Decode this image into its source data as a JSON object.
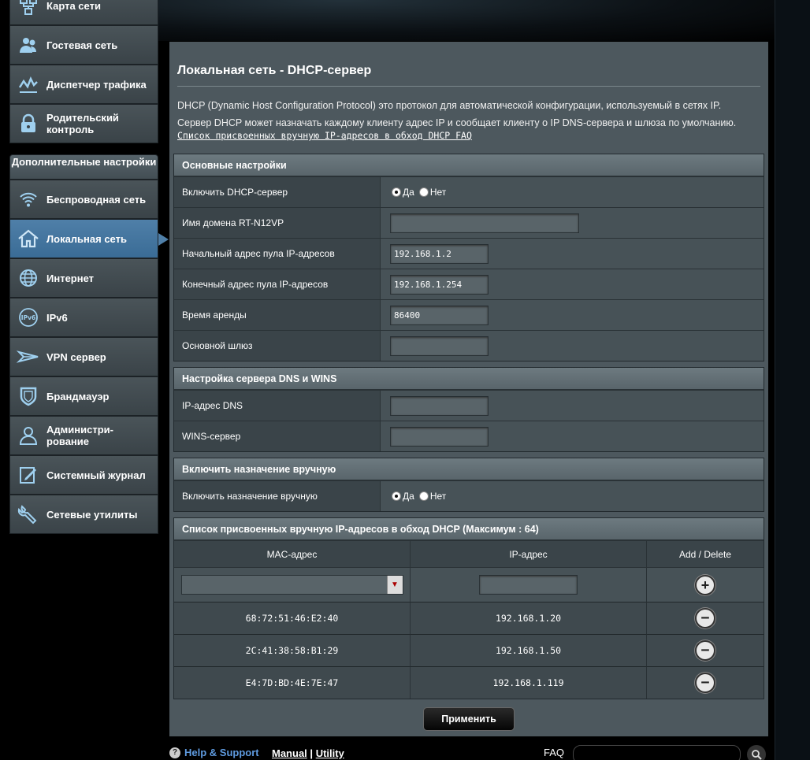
{
  "sidebar": {
    "items_top": [
      {
        "label": "Карта сети",
        "icon": "network-map-icon"
      },
      {
        "label": "Гостевая сеть",
        "icon": "guest-network-icon"
      },
      {
        "label": "Диспетчер трафика",
        "icon": "traffic-manager-icon"
      },
      {
        "label": "Родительский контроль",
        "icon": "parental-control-icon"
      }
    ],
    "section_label": "Дополнительные настройки",
    "items_adv": [
      {
        "label": "Беспроводная сеть",
        "icon": "wireless-icon"
      },
      {
        "label": "Локальная сеть",
        "icon": "lan-home-icon"
      },
      {
        "label": "Интернет",
        "icon": "globe-icon"
      },
      {
        "label": "IPv6",
        "icon": "ipv6-icon"
      },
      {
        "label": "VPN сервер",
        "icon": "vpn-icon"
      },
      {
        "label": "Брандмауэр",
        "icon": "firewall-shield-icon"
      },
      {
        "label": "Администри-рование",
        "icon": "admin-user-icon"
      },
      {
        "label": "Системный журнал",
        "icon": "system-log-icon"
      },
      {
        "label": "Сетевые утилиты",
        "icon": "network-tools-icon"
      }
    ]
  },
  "page": {
    "title": "Локальная сеть - DHCP-сервер",
    "desc_line1": "DHCP (Dynamic Host Configuration Protocol) это протокол для автоматической конфигурации, используемый в сетях IP.",
    "desc_line2": "Сервер DHCP может назначать каждому клиенту адрес IP и сообщает клиенту о IP DNS-сервера и шлюза по умолчанию.",
    "faq_link": "Список присвоенных вручную IP-адресов в обход DHCP FAQ"
  },
  "basic": {
    "header": "Основные настройки",
    "enable_label": "Включить DHCP-сервер",
    "yes": "Да",
    "no": "Нет",
    "domain_label": "Имя домена RT-N12VP",
    "domain_value": "",
    "start_label": "Начальный адрес пула IP-адресов",
    "start_value": "192.168.1.2",
    "end_label": "Конечный адрес пула IP-адресов",
    "end_value": "192.168.1.254",
    "lease_label": "Время аренды",
    "lease_value": "86400",
    "gateway_label": "Основной шлюз",
    "gateway_value": ""
  },
  "dns": {
    "header": "Настройка сервера DNS и WINS",
    "dns_label": "IP-адрес DNS",
    "dns_value": "",
    "wins_label": "WINS-сервер",
    "wins_value": ""
  },
  "manual": {
    "header": "Включить назначение вручную",
    "enable_label": "Включить назначение вручную",
    "yes": "Да",
    "no": "Нет"
  },
  "list": {
    "header": "Список присвоенных вручную IP-адресов в обход DHCP (Максимум : 64)",
    "col_mac": "MAC-адрес",
    "col_ip": "IP-адрес",
    "col_action": "Add / Delete",
    "add_symbol": "+",
    "delete_symbol": "−",
    "rows": [
      {
        "mac": "68:72:51:46:E2:40",
        "ip": "192.168.1.20"
      },
      {
        "mac": "2C:41:38:58:B1:29",
        "ip": "192.168.1.50"
      },
      {
        "mac": "E4:7D:BD:4E:7E:47",
        "ip": "192.168.1.119"
      }
    ]
  },
  "apply_label": "Применить",
  "footer": {
    "help": "Help & Support",
    "manual": "Manual",
    "separator": "|",
    "utility": "Utility",
    "faq": "FAQ"
  }
}
